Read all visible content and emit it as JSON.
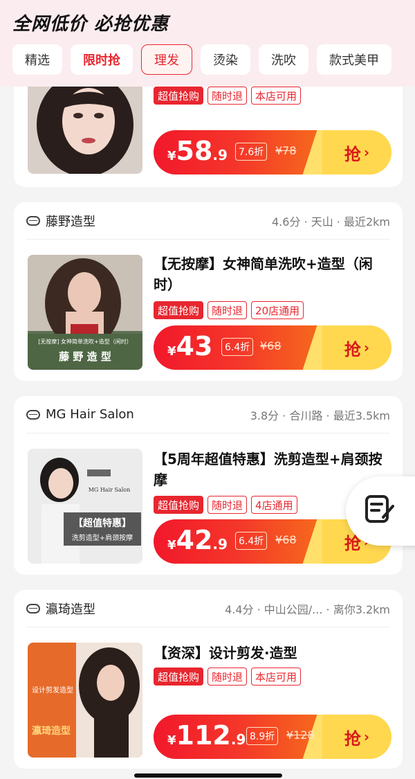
{
  "header": {
    "title": "全网低价 必抢优惠",
    "tabs": [
      "精选",
      "限时抢",
      "理发",
      "烫染",
      "洗吹",
      "款式美甲"
    ]
  },
  "cards": [
    {
      "tags": [
        "超值抢购",
        "随时退",
        "本店可用"
      ],
      "price_int": "58",
      "price_dec": ".9",
      "discount": "7.6折",
      "original": "¥78",
      "cta": "抢"
    },
    {
      "shop_name": "藤野造型",
      "meta": "4.6分 · 天山 · 最近2km",
      "title": "【无按摩】女神简单洗吹+造型（闲时）",
      "thumb_text_1": "[无按摩] 女神简单洗吹+造型（闲时）",
      "thumb_text_2": "藤 野 造 型",
      "tags": [
        "超值抢购",
        "随时退",
        "20店通用"
      ],
      "price_int": "43",
      "price_dec": "",
      "discount": "6.4折",
      "original": "¥68",
      "cta": "抢"
    },
    {
      "shop_name": "MG Hair Salon",
      "meta": "3.8分 · 合川路 · 最近3.5km",
      "title": "【5周年超值特惠】洗剪造型+肩颈按摩",
      "thumb_text_1": "MG Hair Salon",
      "thumb_text_2": "【超值特惠】",
      "thumb_text_3": "洗剪造型+肩颈按摩",
      "tags": [
        "超值抢购",
        "随时退",
        "4店通用"
      ],
      "price_int": "42",
      "price_dec": ".9",
      "discount": "6.4折",
      "original": "¥68",
      "cta": "抢"
    },
    {
      "shop_name": "瀛琦造型",
      "meta": "4.4分 · 中山公园/...  · 离你3.2km",
      "title": "【资深】设计剪发·造型",
      "thumb_text_1": "设计剪发造型",
      "thumb_text_2": "瀛琦造型",
      "tags": [
        "超值抢购",
        "随时退",
        "本店可用"
      ],
      "price_int": "112",
      "price_dec": ".9",
      "discount": "8.9折",
      "original": "¥128",
      "cta": "抢"
    }
  ],
  "currency": "¥",
  "icons": {
    "shop": "shop-icon",
    "float": "edit-note-icon"
  }
}
